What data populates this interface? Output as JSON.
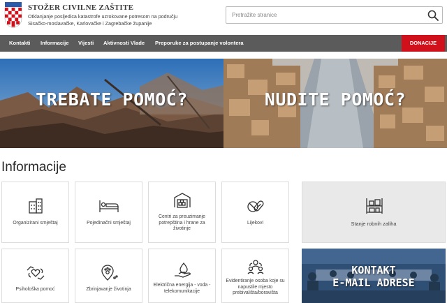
{
  "header": {
    "title": "STOŽER CIVILNE ZAŠTITE",
    "subtitle": "Otklanjanje posljedica katastrofe uzrokovane potresom na području Sisačko-moslavačke, Karlovačke i Zagrebačke županije",
    "search_placeholder": "Pretražite stranice"
  },
  "nav": {
    "items": [
      "Kontakti",
      "Informacije",
      "Vijesti",
      "Aktivnosti Vlade",
      "Preporuke za postupanje volontera"
    ],
    "donate_label": "DONACIJE"
  },
  "banners": {
    "need_help": "TREBATE POMOĆ?",
    "offer_help": "NUDITE POMOĆ?"
  },
  "info": {
    "title": "Informacije",
    "tiles": [
      {
        "label": "Organizirani smještaj",
        "icon": "building-icon"
      },
      {
        "label": "Pojedinačni smještaj",
        "icon": "bed-icon"
      },
      {
        "label": "Centri za preuzimanje potrepština i hrane za životinje",
        "icon": "warehouse-icon"
      },
      {
        "label": "Lijekovi",
        "icon": "pills-icon"
      },
      {
        "label": "Stanje robnih zaliha",
        "icon": "shelves-icon"
      },
      {
        "label": "Psihološka pomoć",
        "icon": "hands-heart-icon"
      },
      {
        "label": "Zbrinjavanje životinja",
        "icon": "paw-pin-icon"
      },
      {
        "label": "Električna energija - voda - telekomunikacije",
        "icon": "water-hand-icon"
      },
      {
        "label": "Evidentiranje osoba koje su napustile mjesto prebivališta/boravišta",
        "icon": "people-group-icon"
      }
    ],
    "contact_line1": "KONTAKT",
    "contact_line2": "E-MAIL ADRESE"
  },
  "colors": {
    "nav_bg": "#5b5b5b",
    "donate_bg": "#d0111b",
    "croatia_red": "#d0111b"
  }
}
